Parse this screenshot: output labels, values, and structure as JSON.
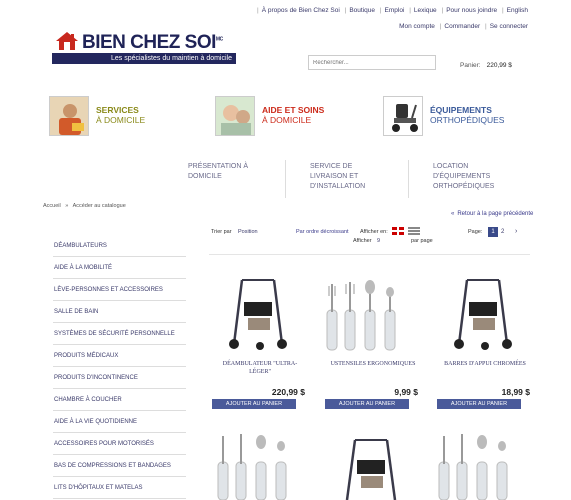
{
  "top_links": [
    "À propos de Bien Chez Soi",
    "Boutique",
    "Emploi",
    "Lexique",
    "Pour nous joindre",
    "English"
  ],
  "account_links": [
    "Mon compte",
    "Commander",
    "Se connecter"
  ],
  "logo": {
    "brand": "BIEN CHEZ SOI",
    "tagline": "Les spécialistes du maintien à domicile"
  },
  "search": {
    "placeholder": "Rechercher..."
  },
  "cart": {
    "label": "Panier:",
    "total": "220,99 $"
  },
  "categories": [
    {
      "line1": "SERVICES",
      "line2": "À DOMICILE",
      "color1": "#8a8a1a",
      "color2": "#8a8a1a"
    },
    {
      "line1": "AIDE ET SOINS",
      "line2": "À DOMICILE",
      "color1": "#cc2a1a",
      "color2": "#cc2a1a"
    },
    {
      "line1": "ÉQUIPEMENTS",
      "line2": "ORTHOPÉDIQUES",
      "color1": "#3a5a9a",
      "color2": "#3a5a9a"
    }
  ],
  "subnav": [
    {
      "line1": "PRÉSENTATION À",
      "line2": "DOMICILE",
      "line3": ""
    },
    {
      "line1": "SERVICE DE",
      "line2": "LIVRAISON ET",
      "line3": "D'INSTALLATION"
    },
    {
      "line1": "LOCATION",
      "line2": "D'ÉQUIPEMENTS",
      "line3": "ORTHOPÉDIQUES"
    }
  ],
  "breadcrumb": {
    "home": "Accueil",
    "sep": "»",
    "current": "Accéder au catalogue"
  },
  "back_link": "Retour à la page précédente",
  "sidebar": [
    "DÉAMBULATEURS",
    "AIDE À LA MOBILITÉ",
    "LÈVE-PERSONNES ET ACCESSOIRES",
    "SALLE DE BAIN",
    "SYSTÈMES DE SÉCURITÉ PERSONNELLE",
    "PRODUITS MÉDICAUX",
    "PRODUITS D'INCONTINENCE",
    "CHAMBRE À COUCHER",
    "AIDE À LA VIE QUOTIDIENNE",
    "ACCESSOIRES POUR MOTORISÉS",
    "BAS DE COMPRESSIONS ET BANDAGES",
    "LITS D'HÔPITAUX ET MATELAS"
  ],
  "toolbar": {
    "sort_label": "Trier par",
    "sort_value": "Position",
    "sort_order": "Par ordre décroissant",
    "view_label": "Afficher en:",
    "show_label": "Afficher",
    "show_value": "9",
    "per_page": "par page",
    "page_label": "Page:",
    "page_current": "1",
    "page_next_num": "2",
    "page_next": "›"
  },
  "products": [
    {
      "name": "DÉAMBULATEUR \"ULTRA-LÉGER\"",
      "price": "220,99 $",
      "button": "AJOUTER AU PANIER",
      "image": "walker-image"
    },
    {
      "name": "USTENSILES ERGONOMIQUES",
      "price": "9,99 $",
      "button": "AJOUTER AU PANIER",
      "image": "utensils-image"
    },
    {
      "name": "BARRES D'APPUI CHROMÉES",
      "price": "18,99 $",
      "button": "AJOUTER AU PANIER",
      "image": "walker-image"
    }
  ]
}
